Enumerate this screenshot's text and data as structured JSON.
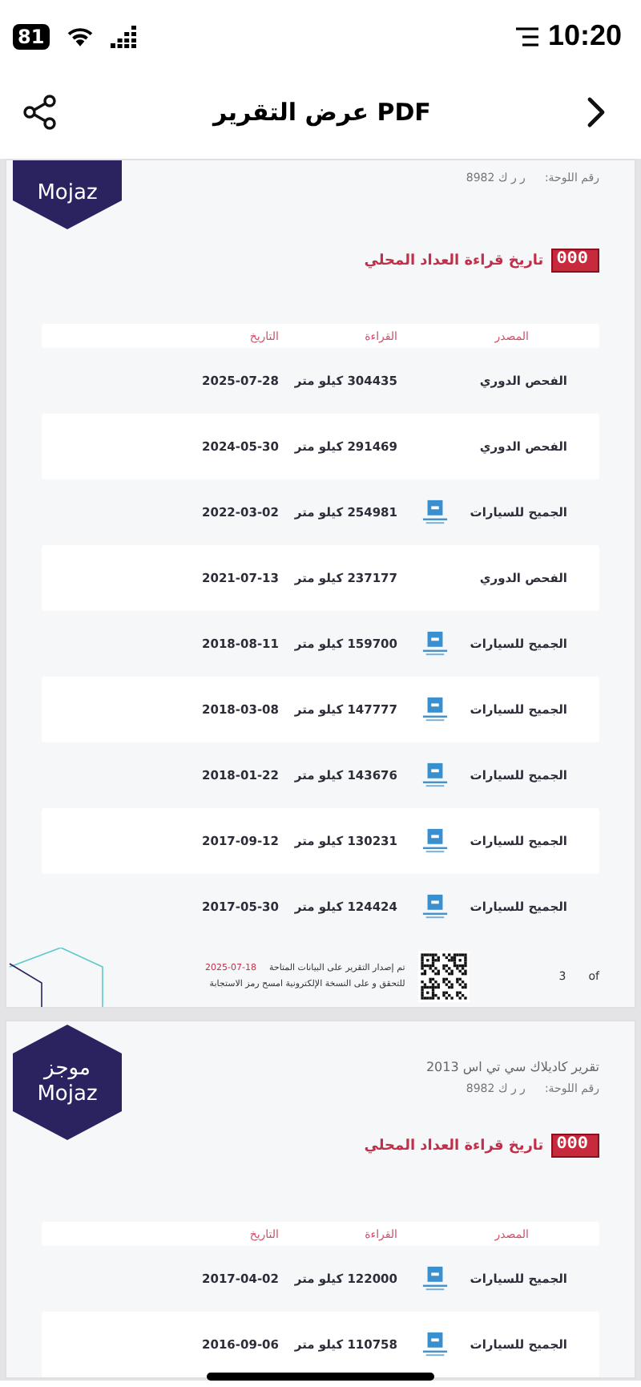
{
  "status_bar": {
    "time": "10:20",
    "battery": "81"
  },
  "nav": {
    "title": "عرض التقرير PDF"
  },
  "pages": [
    {
      "logo_lines": [
        "Mojaz"
      ],
      "cut_top": true,
      "plate_label": "رقم اللوحة:",
      "plate_value": "ر ر ك 8982",
      "odometer_digits": "000",
      "section_title": "تاريخ قراءة العداد المحلي",
      "columns": [
        "المصدر",
        "القراءة",
        "التاريخ"
      ],
      "rows": [
        {
          "source": "الفحص الدوري",
          "kind": "inspection",
          "reading": "304435 كيلو متر",
          "date": "2025-07-28"
        },
        {
          "source": "الفحص الدوري",
          "kind": "inspection",
          "reading": "291469 كيلو متر",
          "date": "2024-05-30"
        },
        {
          "source": "الجميح للسيارات",
          "kind": "dealer",
          "reading": "254981 كيلو متر",
          "date": "2022-03-02"
        },
        {
          "source": "الفحص الدوري",
          "kind": "inspection",
          "reading": "237177 كيلو متر",
          "date": "2021-07-13"
        },
        {
          "source": "الجميح للسيارات",
          "kind": "dealer",
          "reading": "159700 كيلو متر",
          "date": "2018-08-11"
        },
        {
          "source": "الجميح للسيارات",
          "kind": "dealer",
          "reading": "147777 كيلو متر",
          "date": "2018-03-08"
        },
        {
          "source": "الجميح للسيارات",
          "kind": "dealer",
          "reading": "143676 كيلو متر",
          "date": "2018-01-22"
        },
        {
          "source": "الجميح للسيارات",
          "kind": "dealer",
          "reading": "130231 كيلو متر",
          "date": "2017-09-12"
        },
        {
          "source": "الجميح للسيارات",
          "kind": "dealer",
          "reading": "124424 كيلو متر",
          "date": "2017-05-30"
        }
      ],
      "footer": {
        "issued_text": "تم إصدار التقرير على البيانات المتاحة",
        "issued_date": "2025-07-18",
        "verify_text": "للتحقق و على النسخة الإلكترونية امسح رمز الاستجابة",
        "page_number": "3",
        "of_label": "of"
      }
    },
    {
      "logo_lines": [
        "موجز",
        "Mojaz"
      ],
      "cut_top": false,
      "report_title": "تقرير كاديلاك سي تي اس 2013",
      "plate_label": "رقم اللوحة:",
      "plate_value": "ر ر ك 8982",
      "odometer_digits": "000",
      "section_title": "تاريخ قراءة العداد المحلي",
      "columns": [
        "المصدر",
        "القراءة",
        "التاريخ"
      ],
      "rows": [
        {
          "source": "الجميح للسيارات",
          "kind": "dealer",
          "reading": "122000 كيلو متر",
          "date": "2017-04-02"
        },
        {
          "source": "الجميح للسيارات",
          "kind": "dealer",
          "reading": "110758 كيلو متر",
          "date": "2016-09-06"
        }
      ]
    }
  ]
}
